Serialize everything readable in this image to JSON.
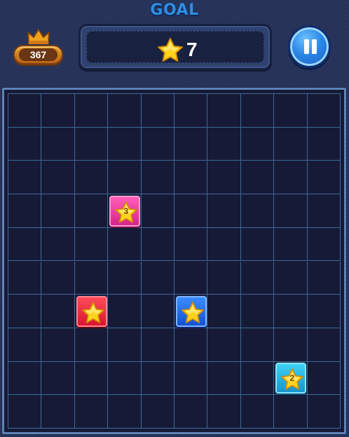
{
  "header": {
    "title": "GOAL",
    "best_score": "367",
    "goal_icon": "star-icon",
    "goal_count": "7",
    "pause_icon": "pause-icon",
    "crown_icon": "crown-icon"
  },
  "board": {
    "columns": 10,
    "rows": 10,
    "tiles": [
      {
        "col": 3,
        "row": 3,
        "color": "pink",
        "label": "3"
      },
      {
        "col": 2,
        "row": 6,
        "color": "red",
        "label": ""
      },
      {
        "col": 5,
        "row": 6,
        "color": "blue",
        "label": ""
      },
      {
        "col": 8,
        "row": 8,
        "color": "cyan",
        "label": "2"
      }
    ]
  },
  "colors": {
    "background": "#26325a",
    "board": "#171a36",
    "grid_line": "#3b6a98",
    "title": "#2f8de0",
    "star": "#ffd21e"
  }
}
